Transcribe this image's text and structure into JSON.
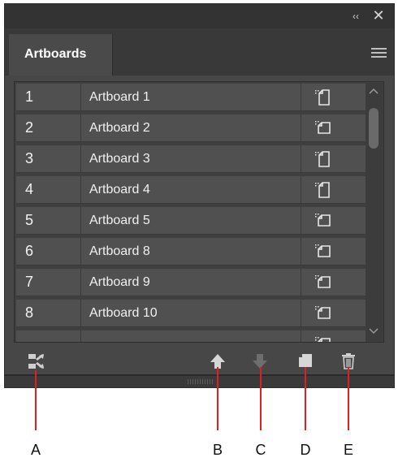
{
  "panel": {
    "tab_label": "Artboards",
    "collapse_glyph": "‹‹",
    "close_glyph": "✕",
    "menu_icon": "hamburger-menu-icon"
  },
  "artboards": [
    {
      "number": "1",
      "name": "Artboard 1",
      "orientation": "portrait"
    },
    {
      "number": "2",
      "name": "Artboard 2",
      "orientation": "landscape"
    },
    {
      "number": "3",
      "name": "Artboard 3",
      "orientation": "portrait"
    },
    {
      "number": "4",
      "name": "Artboard 4",
      "orientation": "portrait"
    },
    {
      "number": "5",
      "name": "Artboard 5",
      "orientation": "landscape"
    },
    {
      "number": "6",
      "name": "Artboard 8",
      "orientation": "landscape"
    },
    {
      "number": "7",
      "name": "Artboard 9",
      "orientation": "landscape"
    },
    {
      "number": "8",
      "name": "Artboard 10",
      "orientation": "landscape"
    }
  ],
  "toolbar": {
    "rearrange_icon": "rearrange-artboards-icon",
    "move_up_icon": "move-up-icon",
    "move_down_icon": "move-down-icon",
    "new_artboard_icon": "new-artboard-icon",
    "delete_icon": "trash-icon"
  },
  "callouts": {
    "a": "A",
    "b": "B",
    "c": "C",
    "d": "D",
    "e": "E"
  },
  "colors": {
    "panel_bg": "#474747",
    "row_bg": "#505050",
    "callout_line": "#e02020",
    "disabled_icon": "#6e6e6e"
  }
}
